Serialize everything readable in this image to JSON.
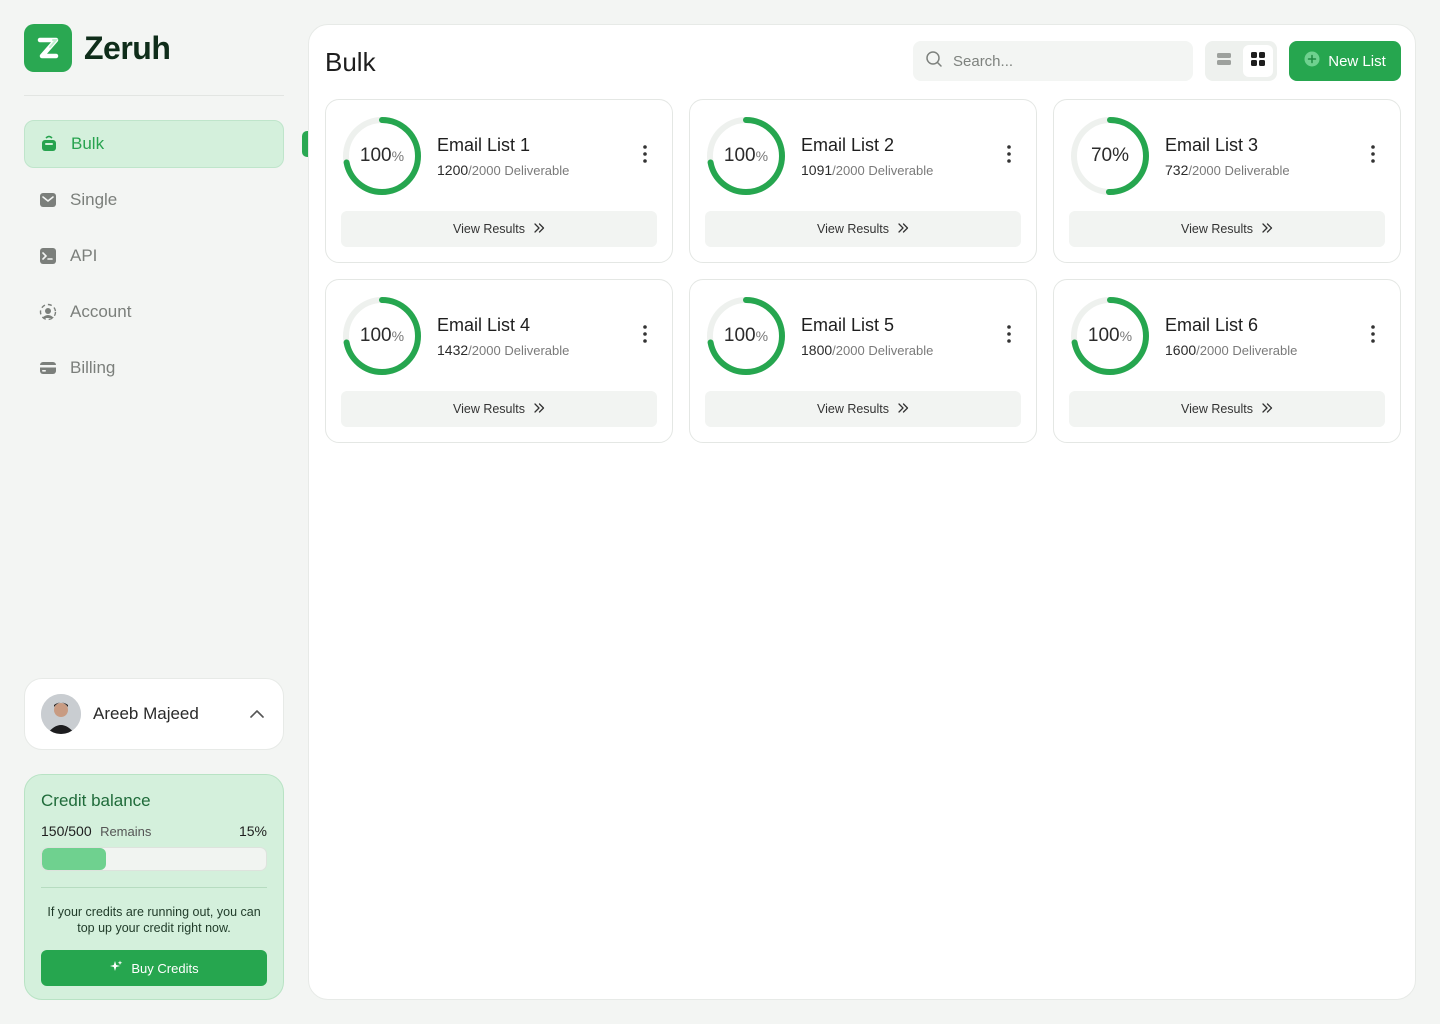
{
  "app": {
    "name": "Zeruh",
    "logo_letter": "Z",
    "brand_color": "#2aa852"
  },
  "sidebar": {
    "items": [
      {
        "label": "Bulk",
        "icon": "bucket-icon",
        "active": true
      },
      {
        "label": "Single",
        "icon": "mail-icon",
        "active": false
      },
      {
        "label": "API",
        "icon": "terminal-icon",
        "active": false
      },
      {
        "label": "Account",
        "icon": "account-icon",
        "active": false
      },
      {
        "label": "Billing",
        "icon": "card-icon",
        "active": false
      }
    ]
  },
  "user": {
    "name": "Areeb Majeed"
  },
  "credit": {
    "title": "Credit balance",
    "used": "150",
    "total": "/500",
    "remains_label": "Remains",
    "percent": "15%",
    "percent_value": 15,
    "message": "If your credits are running out, you can top up your credit right now.",
    "buy_label": "Buy Credits"
  },
  "main": {
    "title": "Bulk",
    "search_placeholder": "Search...",
    "new_button": "New List",
    "view_results": "View Results"
  },
  "lists": [
    {
      "name": "Email List 1",
      "progress": 100,
      "progress_label": "100",
      "progress_unit": "%",
      "count": "1200",
      "total": "/2000",
      "status": "Deliverable"
    },
    {
      "name": "Email List 2",
      "progress": 100,
      "progress_label": "100",
      "progress_unit": "%",
      "count": "1091",
      "total": "/2000",
      "status": "Deliverable"
    },
    {
      "name": "Email List 3",
      "progress": 70,
      "progress_label": "70%",
      "progress_unit": "",
      "count": "732",
      "total": "/2000",
      "status": "Deliverable"
    },
    {
      "name": "Email List 4",
      "progress": 100,
      "progress_label": "100",
      "progress_unit": "%",
      "count": "1432",
      "total": "/2000",
      "status": "Deliverable"
    },
    {
      "name": "Email List 5",
      "progress": 100,
      "progress_label": "100",
      "progress_unit": "%",
      "count": "1800",
      "total": "/2000",
      "status": "Deliverable"
    },
    {
      "name": "Email List 6",
      "progress": 100,
      "progress_label": "100",
      "progress_unit": "%",
      "count": "1600",
      "total": "/2000",
      "status": "Deliverable"
    }
  ]
}
